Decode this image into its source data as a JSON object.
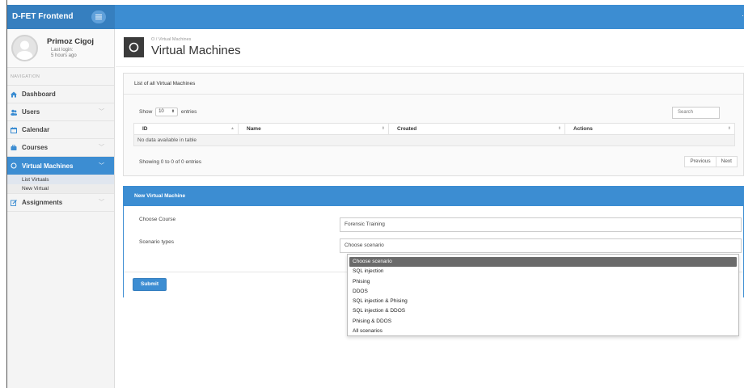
{
  "app": {
    "brand": "D-FET Frontend",
    "topbar_edge_glyph": "·"
  },
  "user": {
    "name": "Primoz Cigoj",
    "last_login_label": "Last login:",
    "last_login_value": "5 hours ago"
  },
  "sidebar": {
    "header": "NAVIGATION",
    "items": [
      {
        "label": "Dashboard",
        "icon": "home-icon",
        "chevron": ""
      },
      {
        "label": "Users",
        "icon": "users-icon",
        "chevron": "﹀"
      },
      {
        "label": "Calendar",
        "icon": "calendar-icon",
        "chevron": ""
      },
      {
        "label": "Courses",
        "icon": "courses-icon",
        "chevron": "﹀"
      },
      {
        "label": "Virtual Machines",
        "icon": "circle-icon",
        "chevron": "﹀"
      },
      {
        "label": "Assignments",
        "icon": "edit-icon",
        "chevron": "﹀"
      }
    ],
    "subitems": [
      {
        "label": "List Virtuals"
      },
      {
        "label": "New Virtual"
      }
    ]
  },
  "page": {
    "breadcrumb": "O  /  Virtual Machines",
    "title": "Virtual Machines"
  },
  "list_box": {
    "title": "List of all Virtual Machines",
    "show_label": "Show",
    "entries_value": "10",
    "entries_label": "entries",
    "search_placeholder": "Search",
    "columns": [
      "ID",
      "Name",
      "Created",
      "Actions"
    ],
    "empty_text": "No data available in table",
    "info": "Showing 0 to 0 of 0 entries",
    "prev": "Previous",
    "next": "Next"
  },
  "form": {
    "title": "New Virtual Machine",
    "course_label": "Choose Course",
    "course_value": "Forensic Training",
    "scenario_label": "Scenario types",
    "scenario_value": "Choose scenario",
    "submit": "Submit",
    "scenario_options": [
      "Choose scenario",
      "SQL injection",
      "Phising",
      "DDOS",
      "SQL injection & Phising",
      "SQL injection & DDOS",
      "Phising & DDOS",
      "All scenarios"
    ]
  },
  "colors": {
    "primary": "#3c8dd2",
    "brand_bg": "#367fbf",
    "selected_option": "#6a6a6a"
  }
}
